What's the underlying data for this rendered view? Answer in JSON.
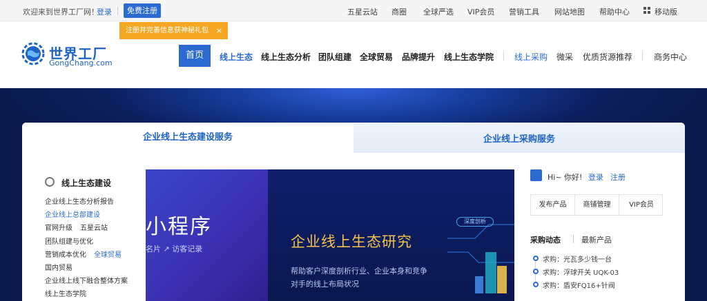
{
  "topbar": {
    "welcome": "欢迎来到世界工厂网！",
    "login": "登录",
    "register": "免费注册",
    "links": [
      "五星云站",
      "商圈",
      "全球严选",
      "VIP会员",
      "营销工具",
      "网站地图",
      "帮助中心"
    ],
    "mobile": "移动版"
  },
  "tooltip": {
    "text": "注册并完善信息获神秘礼包",
    "close": "×"
  },
  "logo": {
    "cn": "世界工厂",
    "en": "GongChang.com"
  },
  "nav": {
    "home": "首页",
    "items": [
      "线上生态",
      "线上生态分析",
      "团队组建",
      "全球贸易",
      "品牌提升",
      "线上生态学院"
    ],
    "secondary": [
      "线上采购",
      "微采",
      "优质货源推荐"
    ],
    "business": "商务中心"
  },
  "tabs": [
    "企业线上生态建设服务",
    "企业线上采购服务"
  ],
  "side": {
    "title": "线上生态建设",
    "links": [
      "企业线上生态分析报告",
      "企业线上总部建设",
      "官网升级",
      "五星云站",
      "团队组建与优化",
      "营销成本优化",
      "全球贸易",
      "国内贸易",
      "企业线上线下融合整体方案",
      "线上生态学院"
    ]
  },
  "slide": {
    "mini_title": "小程序",
    "mini_sub": "名片   ↗ 访客记录",
    "tag": "深度剖析",
    "title": "企业线上生态研究",
    "desc1": "帮助客户深度剖析行业、企业本身和竞争",
    "desc2": "对手的线上布局状况"
  },
  "user": {
    "greeting": "Hi~ 你好!",
    "login": "登录",
    "register": "注册",
    "buttons": [
      "发布产品",
      "商铺管理",
      "VIP会员"
    ]
  },
  "feed": {
    "tabs": [
      "采购动态",
      "最新产品"
    ],
    "items": [
      "求购：光瓦多少钱一台",
      "求购：浮球开关 UQK-03",
      "求购：盾安FQ16+针阀"
    ]
  },
  "colors": {
    "brand": "#2a6ad1",
    "tooltip": "#f5a623",
    "banner": "#0c1f5e",
    "highlight": "#f3c24a"
  }
}
